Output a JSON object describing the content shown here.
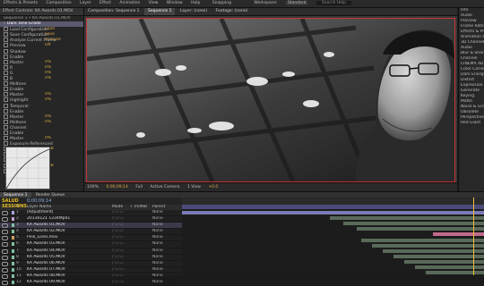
{
  "menubar": {
    "items": [
      "Effects & Presets",
      "Composition",
      "Layer",
      "Effect",
      "Animation",
      "View",
      "Window",
      "Help"
    ],
    "snapping": "Snapping",
    "workspace_label": "Workspace:",
    "workspace_value": "Standard",
    "search_placeholder": "Search Help"
  },
  "left_panel": {
    "tab_label": "Effect Controls: KA Awards 01.MOV",
    "layer_path": "Sequence 1 • KA Awards 01.MOV",
    "effect_name": "Dark Tone Grade",
    "rows": [
      {
        "label": "Load Configuration",
        "value": "Load"
      },
      {
        "label": "Save Configuration",
        "value": "Save"
      },
      {
        "label": "Analyze Current Frame",
        "value": "Analyze"
      },
      {
        "label": "Preview",
        "value": "Off"
      },
      {
        "label": "Shadow",
        "value": ""
      },
      {
        "label": "Enable",
        "value": ""
      },
      {
        "label": "Master",
        "value": "0%"
      },
      {
        "label": "R",
        "value": "0%"
      },
      {
        "label": "G",
        "value": "0%"
      },
      {
        "label": "B",
        "value": "0%"
      },
      {
        "label": "Midtone",
        "value": ""
      },
      {
        "label": "Enable",
        "value": ""
      },
      {
        "label": "Master",
        "value": "0%"
      },
      {
        "label": "Highlight",
        "value": "0%"
      },
      {
        "label": "Temporal",
        "value": ""
      },
      {
        "label": "Enable",
        "value": ""
      },
      {
        "label": "Master",
        "value": "0%"
      },
      {
        "label": "Midtone",
        "value": "0%"
      },
      {
        "label": "Channel",
        "value": ""
      },
      {
        "label": "Enable",
        "value": ""
      },
      {
        "label": "Master",
        "value": "0%"
      },
      {
        "label": "Exposure Referenced",
        "value": ""
      },
      {
        "label": "Channel",
        "value": "RGB"
      },
      {
        "label": "Advanced Mode",
        "value": ""
      },
      {
        "label": "Curves",
        "value": ""
      },
      {
        "label": "Channel",
        "value": "RGB"
      },
      {
        "label": "Curves",
        "value": ""
      }
    ]
  },
  "comp_panel": {
    "tabs": [
      "Composition: Sequence 1",
      "Layer: (none)",
      "Footage: (none)"
    ],
    "active_tab": "Sequence 1",
    "viewer_bar": {
      "zoom": "100%",
      "timecode": "0;00;09;14",
      "resolution": "Full",
      "camera": "Active Camera",
      "views": "1 View",
      "offset": "+0.0"
    }
  },
  "right_panel": {
    "items": [
      "Info",
      "Audio",
      "Preview",
      "Frame Rate",
      "Effects & Presets",
      "Animation Presets",
      "3D Channel",
      "Audio",
      "Blur & Sharpen",
      "Channel",
      "CINEMA 4D",
      "Color Correction",
      "Dark Energy",
      "Distort",
      "Expression Controls",
      "Generate",
      "Keying",
      "Matte",
      "Noise & Grain",
      "Obsolete",
      "Perspective",
      "Red Giant"
    ]
  },
  "timeline": {
    "tabs": [
      "Sequence 1",
      "Render Queue"
    ],
    "active_tab": "Sequence 1",
    "timecode": "0;00;09;14",
    "logo": "SALUD SESSIONS",
    "column_headers": [
      "#",
      "Layer Name",
      "Mode",
      "T TrkMat",
      "Parent"
    ],
    "layers": [
      {
        "num": "1",
        "name": "[Adjustment]",
        "color": "#a8a8e0",
        "parent": "None"
      },
      {
        "num": "2",
        "name": "20130121 1234Mp01",
        "color": "#c0a0d0",
        "parent": "None"
      },
      {
        "num": "3",
        "name": "KA Awards 01.MOV",
        "color": "#80c0a0",
        "parent": "None"
      },
      {
        "num": "4",
        "name": "KA Awards 02.MOV",
        "color": "#80c0a0",
        "parent": "None"
      },
      {
        "num": "5",
        "name": "Pink_Lines.mov",
        "color": "#d0a060",
        "parent": "None"
      },
      {
        "num": "6",
        "name": "KA Awards 03.MOV",
        "color": "#80c0a0",
        "parent": "None"
      },
      {
        "num": "7",
        "name": "KA Awards 04.MOV",
        "color": "#80c0a0",
        "parent": "None"
      },
      {
        "num": "8",
        "name": "KA Awards 05.MOV",
        "color": "#80c0a0",
        "parent": "None"
      },
      {
        "num": "9",
        "name": "KA Awards 06.MOV",
        "color": "#80c0a0",
        "parent": "None"
      },
      {
        "num": "10",
        "name": "KA Awards 07.MOV",
        "color": "#80c0a0",
        "parent": "None"
      },
      {
        "num": "11",
        "name": "KA Awards 08.MOV",
        "color": "#80c0a0",
        "parent": "None"
      },
      {
        "num": "12",
        "name": "KA Awards 09.MOV",
        "color": "#80c0a0",
        "parent": "None"
      }
    ],
    "colors": {
      "playhead": "#f0c030",
      "work_area": "#4a4a7a",
      "bar_selected": "#7a7ab8",
      "bar_other": "#5a6a5a",
      "bar_pink": "#c06a8a"
    }
  }
}
